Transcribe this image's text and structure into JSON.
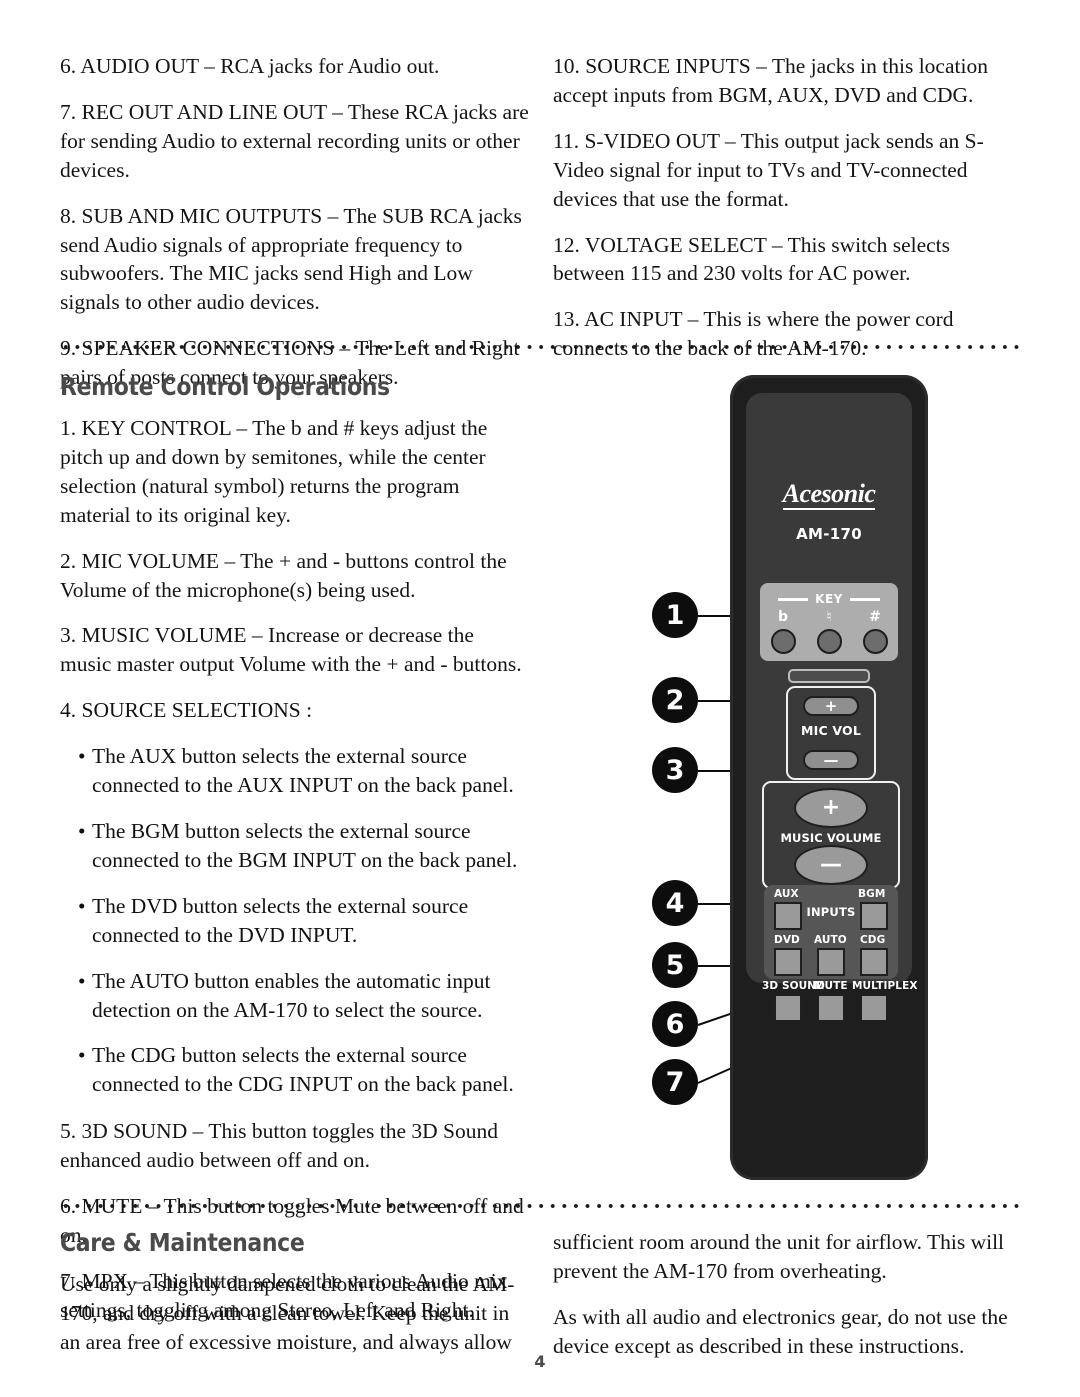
{
  "left_column_top": [
    "6. AUDIO OUT – RCA jacks for Audio out.",
    "7. REC OUT AND LINE OUT – These RCA jacks are for sending Audio to external recording units or other devices.",
    "8. SUB AND MIC OUTPUTS – The SUB RCA jacks send Audio signals of appropriate frequency to subwoofers. The MIC jacks send High and Low signals to other audio devices.",
    "9. SPEAKER CONNECTIONS – The Left and Right pairs of posts connect to your speakers."
  ],
  "right_column_top": [
    "10. SOURCE INPUTS – The jacks in this location accept inputs from BGM, AUX, DVD and CDG.",
    "11. S-VIDEO OUT – This output jack sends an S-Video signal for input to TVs and TV-connected devices that use the format.",
    "12. VOLTAGE SELECT – This switch selects between 115 and 230 volts for AC power.",
    "13. AC INPUT – This is where the power cord connects to the back of the AM-170."
  ],
  "remote_section": {
    "heading": "Remote Control Operations",
    "items": [
      "1. KEY CONTROL –  The b and # keys adjust the pitch up and down by semitones, while the center selection (natural symbol) returns the program material to its original key.",
      "2. MIC VOLUME –  The + and - buttons control the Volume of the microphone(s) being used.",
      "3. MUSIC VOLUME –  Increase or decrease the music master output Volume with the + and - buttons.",
      "4. SOURCE SELECTIONS :"
    ],
    "bullets": [
      "The AUX button selects the external source connected to the AUX INPUT on the back panel.",
      "The BGM button selects the external source connected to the BGM INPUT on the back panel.",
      "The DVD button selects the external source connected to the DVD INPUT.",
      "The AUTO button enables the automatic input detection on the AM-170 to select the source.",
      "The CDG button selects the external source connected to the CDG INPUT on the back panel."
    ],
    "bullet_marker": "•",
    "items_tail": [
      "5. 3D SOUND –  This button toggles the 3D Sound enhanced audio between off and on.",
      "6. MUTE – This button toggles Mute between off and on.",
      "7. MPX – This button selects the various Audio mix settings, toggling among Stereo, Left and Right."
    ]
  },
  "care_section": {
    "heading": "Care & Maintenance",
    "left_paragraphs": [
      "Use only a slightly dampened cloth to clean the AM-170, and dry off with a clean towel. Keep the unit in an area free of excessive moisture, and always allow"
    ],
    "right_paragraphs": [
      "sufficient room around the unit for airflow. This will prevent the AM-170 from overheating.",
      "As with all audio and electronics gear, do not use the device except as described in these instructions."
    ]
  },
  "remote_figure": {
    "brand": "Acesonic",
    "brand_initial": "A",
    "brand_rest": "cesonic",
    "model": "AM-170",
    "key_panel": {
      "title": "KEY",
      "labels": [
        "b",
        "♮",
        "#"
      ]
    },
    "mic_vol": {
      "label": "MIC VOL",
      "plus": "+",
      "minus": "—"
    },
    "music_vol": {
      "label": "MUSIC VOLUME",
      "plus": "+",
      "minus": "—"
    },
    "inputs": {
      "title": "INPUTS",
      "aux": "AUX",
      "bgm": "BGM",
      "dvd": "DVD",
      "auto": "AUTO",
      "cdg": "CDG"
    },
    "bottom_buttons": {
      "sound3d": "3D SOUND",
      "mute": "MUTE",
      "multiplex": "MULTIPLEX"
    },
    "callouts": [
      "1",
      "2",
      "3",
      "4",
      "5",
      "6",
      "7"
    ]
  },
  "footer": {
    "page_number": "4"
  },
  "colors": {
    "heading_gray": "#4a4a4a",
    "remote_body": "#1e1e1e",
    "remote_inner": "#3a3a3a",
    "key_panel": "#adadad",
    "button_gray": "#9a9a9a",
    "callout_black": "#0d0d0d",
    "text_black": "#141414"
  }
}
